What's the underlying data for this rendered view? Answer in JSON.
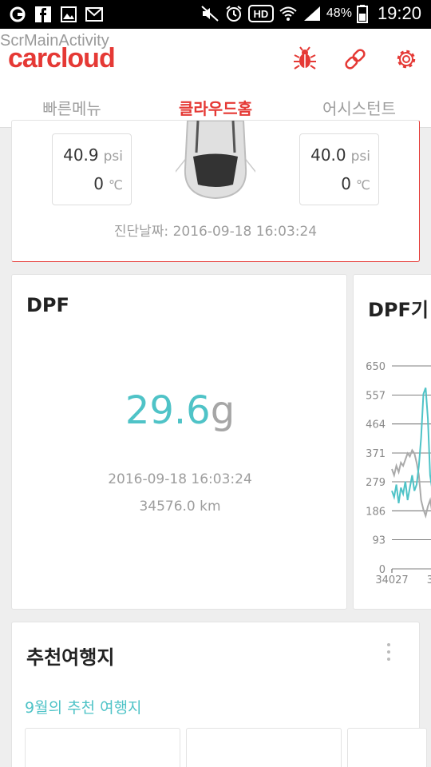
{
  "status_bar": {
    "battery": "48%",
    "time": "19:20",
    "hd_badge": "HD",
    "icons_left": [
      "o-app-icon",
      "facebook-icon",
      "gallery-icon",
      "mail-icon"
    ],
    "icons_right": [
      "mute-icon",
      "alarm-icon",
      "hd-icon",
      "wifi-icon",
      "signal-icon",
      "battery-icon"
    ]
  },
  "app_bar": {
    "debug_label": "ScrMainActivity",
    "logo": "carcloud",
    "actions": [
      "bug-icon",
      "link-icon",
      "gear-icon"
    ],
    "accent": "#e53935"
  },
  "tabs": [
    {
      "label": "빠른메뉴",
      "selected": false
    },
    {
      "label": "클라우드홈",
      "selected": true
    },
    {
      "label": "어시스턴트",
      "selected": false
    }
  ],
  "tire_card": {
    "front_left": {
      "psi": "40.9",
      "psi_unit": "psi",
      "temp": "0",
      "temp_unit": "℃"
    },
    "front_right": {
      "psi": "40.0",
      "psi_unit": "psi",
      "temp": "0",
      "temp_unit": "℃"
    },
    "diag_date": "진단날짜: 2016-09-18 16:03:24"
  },
  "dpf_card": {
    "title": "DPF",
    "value": "29.6",
    "unit": "g",
    "date": "2016-09-18 16:03:24",
    "km": "34576.0 km",
    "value_color": "#4fc3c7"
  },
  "chart_card": {
    "title": "DPF기"
  },
  "chart_data": {
    "type": "line",
    "y_ticks": [
      "650",
      "557",
      "464",
      "371",
      "279",
      "186",
      "93",
      "0"
    ],
    "x_ticks": [
      "34027",
      "34"
    ],
    "ylim": [
      0,
      650
    ],
    "series": [
      {
        "color": "#4fc3c7",
        "y": [
          250,
          230,
          270,
          210,
          260,
          240,
          280,
          220,
          260,
          300,
          250,
          270,
          330,
          420,
          560,
          580,
          480,
          300,
          250,
          240,
          260,
          230,
          250
        ]
      },
      {
        "color": "#aaaaaa",
        "y": [
          320,
          300,
          330,
          310,
          340,
          330,
          350,
          370,
          360,
          380,
          370,
          340,
          300,
          220,
          190,
          170,
          200,
          220,
          180,
          200,
          190,
          210,
          200
        ]
      }
    ]
  },
  "rec_card": {
    "title": "추천여행지",
    "subtitle": "9월의 추천 여행지"
  }
}
